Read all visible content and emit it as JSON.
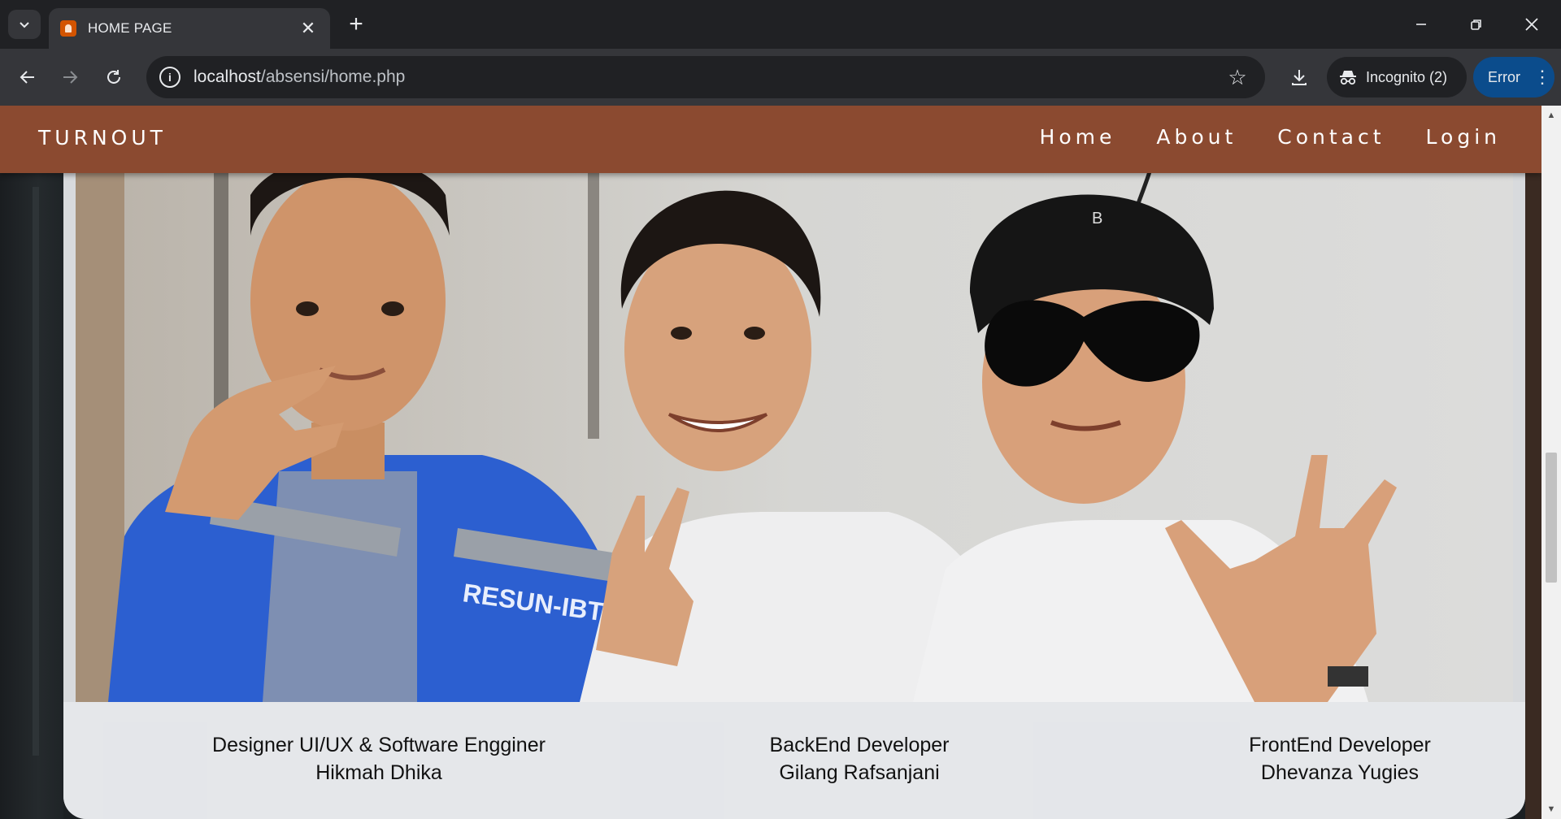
{
  "browser": {
    "tab_title": "HOME PAGE",
    "url_host": "localhost",
    "url_path": "/absensi/home.php",
    "incognito_label": "Incognito (2)",
    "error_label": "Error"
  },
  "site": {
    "brand": "TURNOUT",
    "nav": [
      "Home",
      "About",
      "Contact",
      "Login"
    ],
    "brand_color": "#8b4a30"
  },
  "team": [
    {
      "role": "Designer UI/UX & Software Engginer",
      "name": "Hikmah Dhika"
    },
    {
      "role": "BackEnd Developer",
      "name": "Gilang Rafsanjani"
    },
    {
      "role": "FrontEnd Developer",
      "name": "Dhevanza Yugies"
    }
  ],
  "photo": {
    "vest_text": "RESUN-IBTA"
  }
}
